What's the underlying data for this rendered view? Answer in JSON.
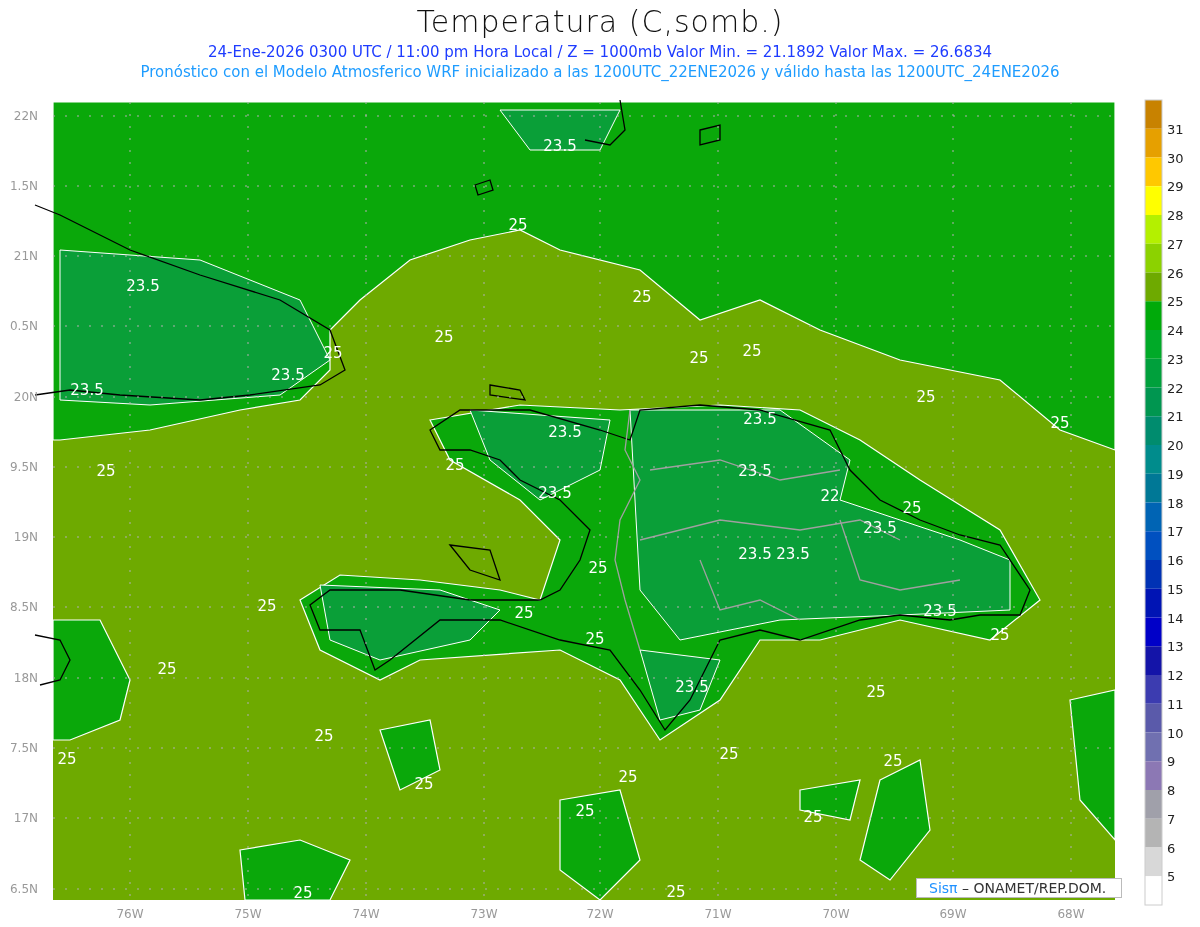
{
  "title": "Temperatura (C,somb.)",
  "subtitle_lines": [
    "24-Ene-2026 0300 UTC / 11:00 pm Hora Local / Z = 1000mb  Valor Min. = 21.1892  Valor Max. = 26.6834",
    "Pronóstico con el Modelo Atmosferico WRF inicializado a las 1200UTC_22ENE2026 y válido hasta las  1200UTC_24ENE2026"
  ],
  "y_ticks": [
    "22N",
    "1.5N",
    "21N",
    "0.5N",
    "20N",
    "9.5N",
    "19N",
    "8.5N",
    "18N",
    "7.5N",
    "17N",
    "6.5N"
  ],
  "x_ticks": [
    "76W",
    "75W",
    "74W",
    "73W",
    "72W",
    "71W",
    "70W",
    "69W",
    "68W"
  ],
  "contour_labels": [
    "23.5",
    "25",
    "23.5",
    "25",
    "25",
    "25",
    "25",
    "25",
    "23.5",
    "23.5",
    "25",
    "25",
    "23.5",
    "23.5",
    "25",
    "25",
    "23.5",
    "23.5",
    "22",
    "25",
    "23.5",
    "25",
    "23.5",
    "23.5",
    "25",
    "25",
    "23.5",
    "25",
    "25",
    "25",
    "23.5",
    "25",
    "25",
    "25",
    "25",
    "25",
    "25",
    "25",
    "25",
    "25",
    "25",
    "25"
  ],
  "colorbar": {
    "boxes": [
      {
        "color": "#c88200"
      },
      {
        "color": "#e6a000"
      },
      {
        "color": "#ffc800"
      },
      {
        "color": "#ffff00"
      },
      {
        "color": "#b4f000"
      },
      {
        "color": "#8cd200"
      },
      {
        "color": "#6eaa00"
      },
      {
        "color": "#00aa0a"
      },
      {
        "color": "#00aa28"
      },
      {
        "color": "#00a03c"
      },
      {
        "color": "#009650"
      },
      {
        "color": "#008c6e"
      },
      {
        "color": "#008c8c"
      },
      {
        "color": "#007896"
      },
      {
        "color": "#0064b4"
      },
      {
        "color": "#0050c0"
      },
      {
        "color": "#0032b4"
      },
      {
        "color": "#0014b4"
      },
      {
        "color": "#0000c8"
      },
      {
        "color": "#1414a8"
      },
      {
        "color": "#3c3cb0"
      },
      {
        "color": "#5a5aaa"
      },
      {
        "color": "#7070b0"
      },
      {
        "color": "#8c78b4"
      },
      {
        "color": "#a0a0aa"
      },
      {
        "color": "#b4b4b4"
      },
      {
        "color": "#d8d8d8"
      },
      {
        "color": "#ffffff"
      }
    ],
    "labels": [
      "31",
      "30",
      "29",
      "28",
      "27",
      "26",
      "25",
      "24",
      "23",
      "22",
      "21",
      "20",
      "19",
      "18",
      "17",
      "16",
      "15",
      "14",
      "13",
      "12",
      "11",
      "10",
      "9",
      "8",
      "7",
      "6",
      "5"
    ]
  },
  "credit": {
    "brand": "Sisπ",
    "text": "– ONAMET/REP.DOM."
  }
}
